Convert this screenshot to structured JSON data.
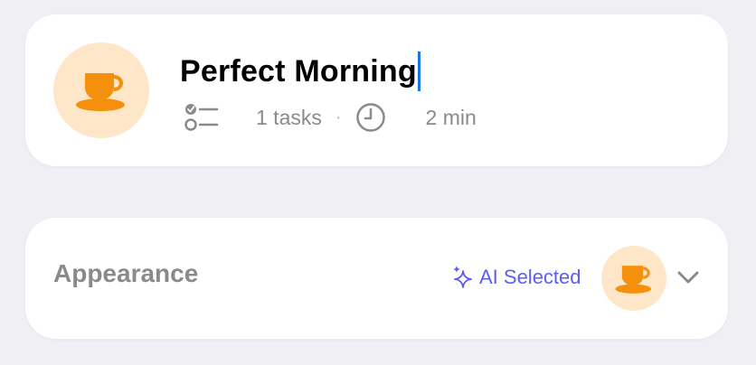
{
  "shortcut": {
    "title": "Perfect Morning",
    "icon": "teacup-icon",
    "tasks_label": "1 tasks",
    "separator": "·",
    "duration_label": "2 min"
  },
  "appearance": {
    "label": "Appearance",
    "ai_label": "AI Selected",
    "icon": "teacup-icon",
    "expand_icon": "chevron-down-icon"
  },
  "colors": {
    "background": "#efeff4",
    "card": "#ffffff",
    "icon_circle": "#fde7c8",
    "icon_orange": "#f4900c",
    "accent_purple": "#5b5ef0",
    "caret_blue": "#1a73e8",
    "secondary_text": "#8a8a8e"
  }
}
